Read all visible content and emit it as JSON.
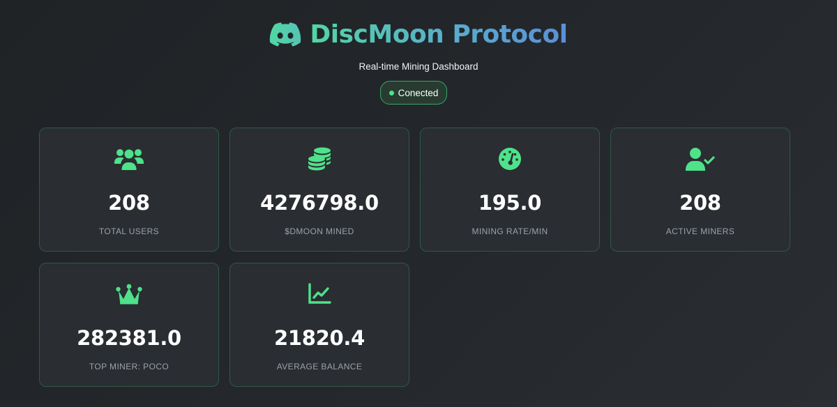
{
  "header": {
    "title": "DiscMoon Protocol",
    "subtitle": "Real-time Mining Dashboard",
    "status": "Conected",
    "logo_icon": "discord-icon"
  },
  "colors": {
    "accent": "#4ee28a",
    "title_gradient_start": "#52d6a4",
    "title_gradient_end": "#5b8fd6",
    "card_background": "#2a2d31",
    "card_border": "#2d5a45",
    "label_color": "#9aa3ab"
  },
  "stats": [
    {
      "icon": "users-icon",
      "value": "208",
      "label": "TOTAL USERS"
    },
    {
      "icon": "coins-icon",
      "value": "4276798.0",
      "label": "$DMOON MINED"
    },
    {
      "icon": "gauge-icon",
      "value": "195.0",
      "label": "MINING RATE/MIN"
    },
    {
      "icon": "user-check-icon",
      "value": "208",
      "label": "ACTIVE MINERS"
    },
    {
      "icon": "crown-icon",
      "value": "282381.0",
      "label": "TOP MINER: POCO"
    },
    {
      "icon": "chart-line-icon",
      "value": "21820.4",
      "label": "AVERAGE BALANCE"
    }
  ]
}
